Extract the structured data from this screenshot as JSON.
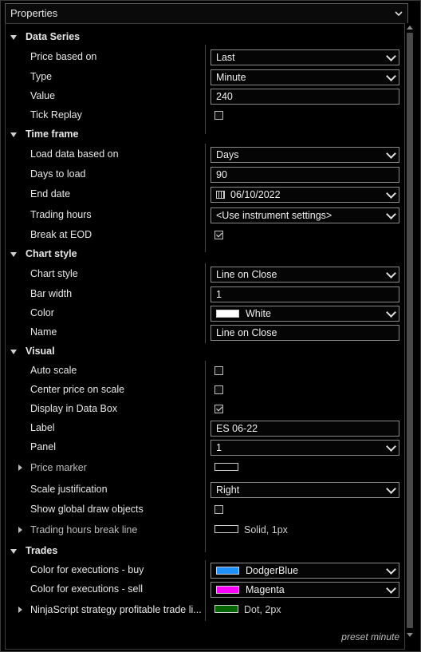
{
  "window": {
    "title": "Properties"
  },
  "categories": {
    "data_series": "Data Series",
    "time_frame": "Time frame",
    "chart_style": "Chart style",
    "visual": "Visual",
    "trades": "Trades"
  },
  "rows": {
    "price_based_on": {
      "label": "Price based on",
      "value": "Last"
    },
    "type": {
      "label": "Type",
      "value": "Minute"
    },
    "value": {
      "label": "Value",
      "value": "240"
    },
    "tick_replay": {
      "label": "Tick Replay",
      "checked": false
    },
    "load_data_based_on": {
      "label": "Load data based on",
      "value": "Days"
    },
    "days_to_load": {
      "label": "Days to load",
      "value": "90"
    },
    "end_date": {
      "label": "End date",
      "value": "06/10/2022"
    },
    "trading_hours": {
      "label": "Trading hours",
      "value": "<Use instrument settings>"
    },
    "break_at_eod": {
      "label": "Break at EOD",
      "checked": true
    },
    "chart_style": {
      "label": "Chart style",
      "value": "Line on Close"
    },
    "bar_width": {
      "label": "Bar width",
      "value": "1"
    },
    "color": {
      "label": "Color",
      "value": "White",
      "swatch": "#ffffff"
    },
    "name": {
      "label": "Name",
      "value": "Line on Close"
    },
    "auto_scale": {
      "label": "Auto scale",
      "checked": false
    },
    "center_price": {
      "label": "Center price on scale",
      "checked": false
    },
    "display_data_box": {
      "label": "Display in Data Box",
      "checked": true
    },
    "label": {
      "label": "Label",
      "value": "ES 06-22"
    },
    "panel": {
      "label": "Panel",
      "value": "1"
    },
    "price_marker": {
      "label": "Price marker",
      "swatch": "#000000"
    },
    "scale_justification": {
      "label": "Scale justification",
      "value": "Right"
    },
    "show_global_draw": {
      "label": "Show global draw objects",
      "checked": false
    },
    "trading_hours_break": {
      "label": "Trading hours break line",
      "value": "Solid, 1px",
      "swatch": "#000000"
    },
    "exec_buy": {
      "label": "Color for executions - buy",
      "value": "DodgerBlue",
      "swatch": "#1e90ff"
    },
    "exec_sell": {
      "label": "Color for executions - sell",
      "value": "Magenta",
      "swatch": "#ff00ff"
    },
    "ninjascript": {
      "label": "NinjaScript strategy profitable trade li...",
      "value": "Dot, 2px",
      "swatch": "#006400"
    }
  },
  "footer": {
    "text": "preset minute"
  }
}
